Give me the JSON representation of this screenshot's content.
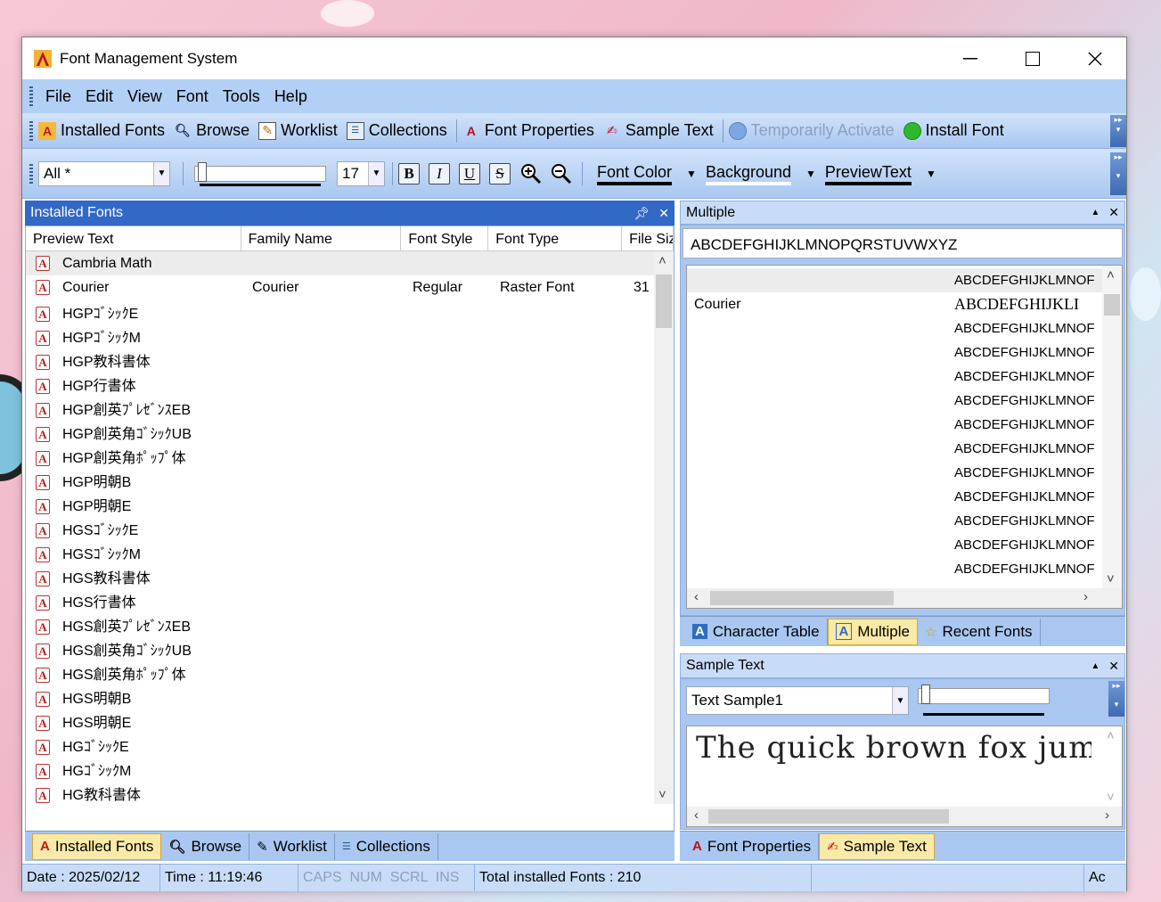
{
  "window": {
    "title": "Font Management System"
  },
  "menu": [
    "File",
    "Edit",
    "View",
    "Font",
    "Tools",
    "Help"
  ],
  "toolbar1": [
    {
      "label": "Installed Fonts",
      "icon": "installed-fonts-icon",
      "enabled": true
    },
    {
      "label": "Browse",
      "icon": "browse-icon",
      "enabled": true
    },
    {
      "label": "Worklist",
      "icon": "worklist-icon",
      "enabled": true
    },
    {
      "label": "Collections",
      "icon": "collections-icon",
      "enabled": true
    },
    {
      "label": "Font Properties",
      "icon": "font-properties-icon",
      "enabled": true
    },
    {
      "label": "Sample Text",
      "icon": "sample-text-icon",
      "enabled": true
    },
    {
      "label": "Temporarily Activate",
      "icon": "activate-icon",
      "enabled": false
    },
    {
      "label": "Install Font",
      "icon": "install-font-icon",
      "enabled": true
    }
  ],
  "toolbar2": {
    "filter": "All *",
    "size": "17",
    "format": [
      "B",
      "I",
      "U",
      "S"
    ],
    "font_color": "Font Color",
    "background": "Background",
    "preview_text": "PreviewText"
  },
  "installed_panel": {
    "title": "Installed Fonts",
    "columns": [
      "Preview Text",
      "Family Name",
      "Font Style",
      "Font Type",
      "File Siz"
    ],
    "rows": [
      {
        "name": "Cambria Math",
        "family": "",
        "style": "",
        "type": "",
        "size": ""
      },
      {
        "name": "Courier",
        "family": "Courier",
        "style": "Regular",
        "type": "Raster Font",
        "size": "31"
      },
      {
        "name": "HGPｺﾞｼｯｸE",
        "family": "",
        "style": "",
        "type": "",
        "size": ""
      },
      {
        "name": "HGPｺﾞｼｯｸM",
        "family": "",
        "style": "",
        "type": "",
        "size": ""
      },
      {
        "name": "HGP教科書体",
        "family": "",
        "style": "",
        "type": "",
        "size": ""
      },
      {
        "name": "HGP行書体",
        "family": "",
        "style": "",
        "type": "",
        "size": ""
      },
      {
        "name": "HGP創英ﾌﾟﾚｾﾞﾝｽEB",
        "family": "",
        "style": "",
        "type": "",
        "size": ""
      },
      {
        "name": "HGP創英角ｺﾞｼｯｸUB",
        "family": "",
        "style": "",
        "type": "",
        "size": ""
      },
      {
        "name": "HGP創英角ﾎﾟｯﾌﾟ体",
        "family": "",
        "style": "",
        "type": "",
        "size": ""
      },
      {
        "name": "HGP明朝B",
        "family": "",
        "style": "",
        "type": "",
        "size": ""
      },
      {
        "name": "HGP明朝E",
        "family": "",
        "style": "",
        "type": "",
        "size": ""
      },
      {
        "name": "HGSｺﾞｼｯｸE",
        "family": "",
        "style": "",
        "type": "",
        "size": ""
      },
      {
        "name": "HGSｺﾞｼｯｸM",
        "family": "",
        "style": "",
        "type": "",
        "size": ""
      },
      {
        "name": "HGS教科書体",
        "family": "",
        "style": "",
        "type": "",
        "size": ""
      },
      {
        "name": "HGS行書体",
        "family": "",
        "style": "",
        "type": "",
        "size": ""
      },
      {
        "name": "HGS創英ﾌﾟﾚｾﾞﾝｽEB",
        "family": "",
        "style": "",
        "type": "",
        "size": ""
      },
      {
        "name": "HGS創英角ｺﾞｼｯｸUB",
        "family": "",
        "style": "",
        "type": "",
        "size": ""
      },
      {
        "name": "HGS創英角ﾎﾟｯﾌﾟ体",
        "family": "",
        "style": "",
        "type": "",
        "size": ""
      },
      {
        "name": "HGS明朝B",
        "family": "",
        "style": "",
        "type": "",
        "size": ""
      },
      {
        "name": "HGS明朝E",
        "family": "",
        "style": "",
        "type": "",
        "size": ""
      },
      {
        "name": "HGｺﾞｼｯｸE",
        "family": "",
        "style": "",
        "type": "",
        "size": ""
      },
      {
        "name": "HGｺﾞｼｯｸM",
        "family": "",
        "style": "",
        "type": "",
        "size": ""
      },
      {
        "name": "HG教科書体",
        "family": "",
        "style": "",
        "type": "",
        "size": ""
      }
    ],
    "tabs": [
      "Installed Fonts",
      "Browse",
      "Worklist",
      "Collections"
    ]
  },
  "multiple_panel": {
    "title": "Multiple",
    "input": "ABCDEFGHIJKLMNOPQRSTUVWXYZ",
    "rows": [
      {
        "name": "",
        "preview": "ABCDEFGHIJKLMNOF"
      },
      {
        "name": "Courier",
        "preview": "ABCDEFGHIJKLI"
      },
      {
        "name": "",
        "preview": "ABCDEFGHIJKLMNOF"
      },
      {
        "name": "",
        "preview": "ABCDEFGHIJKLMNOF"
      },
      {
        "name": "",
        "preview": "ABCDEFGHIJKLMNOF"
      },
      {
        "name": "",
        "preview": "ABCDEFGHIJKLMNOF"
      },
      {
        "name": "",
        "preview": "ABCDEFGHIJKLMNOF"
      },
      {
        "name": "",
        "preview": "ABCDEFGHIJKLMNOF"
      },
      {
        "name": "",
        "preview": "ABCDEFGHIJKLMNOF"
      },
      {
        "name": "",
        "preview": "ABCDEFGHIJKLMNOF"
      },
      {
        "name": "",
        "preview": "ABCDEFGHIJKLMNOF"
      },
      {
        "name": "",
        "preview": "ABCDEFGHIJKLMNOF"
      },
      {
        "name": "",
        "preview": "ABCDEFGHIJKLMNOF"
      }
    ],
    "tabs": [
      "Character Table",
      "Multiple",
      "Recent Fonts"
    ]
  },
  "sample_panel": {
    "title": "Sample Text",
    "select": "Text Sample1",
    "text": "The quick brown fox jumps o",
    "tabs": [
      "Font Properties",
      "Sample Text"
    ]
  },
  "status": {
    "date": "Date : 2025/02/12",
    "time": "Time : 11:19:46",
    "keys": "CAPS  NUM  SCRL  INS",
    "total": "Total installed Fonts : 210",
    "extra": "Ac"
  }
}
